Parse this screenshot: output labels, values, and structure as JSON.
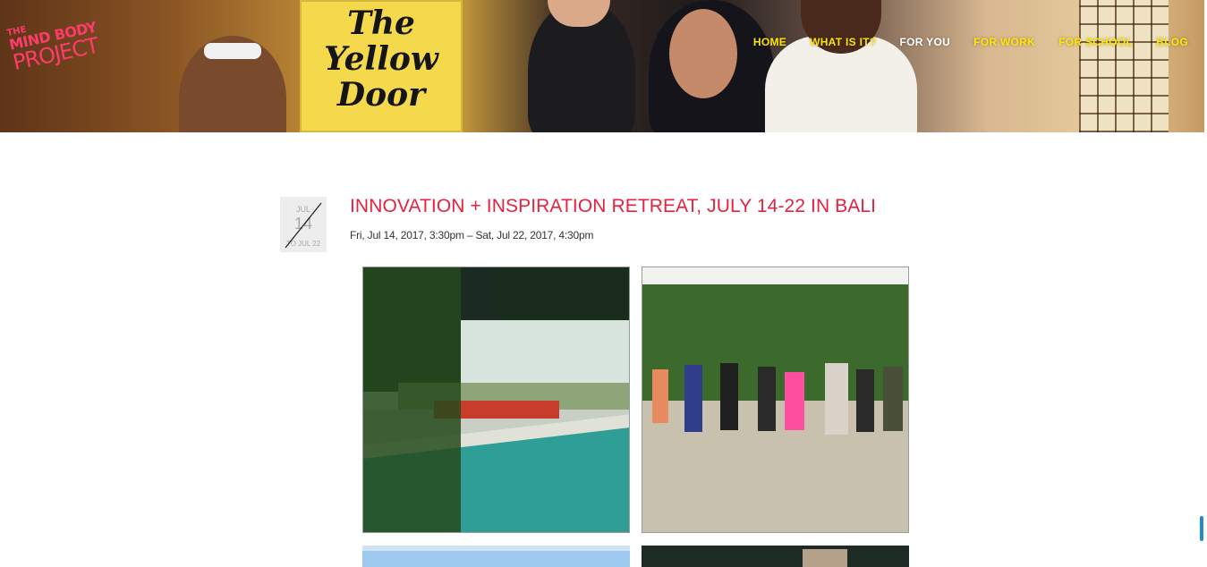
{
  "logo": {
    "line1": "THE",
    "line2": "MIND BODY",
    "line3": "PROJECT"
  },
  "hero": {
    "sign_line1": "The",
    "sign_line2": "Yellow",
    "sign_line3": "Door"
  },
  "nav": {
    "items": [
      {
        "label": "HOME"
      },
      {
        "label": "WHAT IS IT?"
      },
      {
        "label": "FOR YOU"
      },
      {
        "label": "FOR WORK"
      },
      {
        "label": "FOR SCHOOL"
      },
      {
        "label": "BLOG"
      }
    ],
    "active_color": "#ffffff",
    "color": "#ffe600"
  },
  "event": {
    "badge": {
      "month": "JUL",
      "day": "14",
      "end": "TO JUL 22"
    },
    "title": "INNOVATION + INSPIRATION RETREAT, JULY 14-22 IN BALI",
    "dates": "Fri, Jul 14, 2017, 3:30pm – Sat, Jul 22, 2017, 4:30pm",
    "title_color": "#e8213f"
  }
}
